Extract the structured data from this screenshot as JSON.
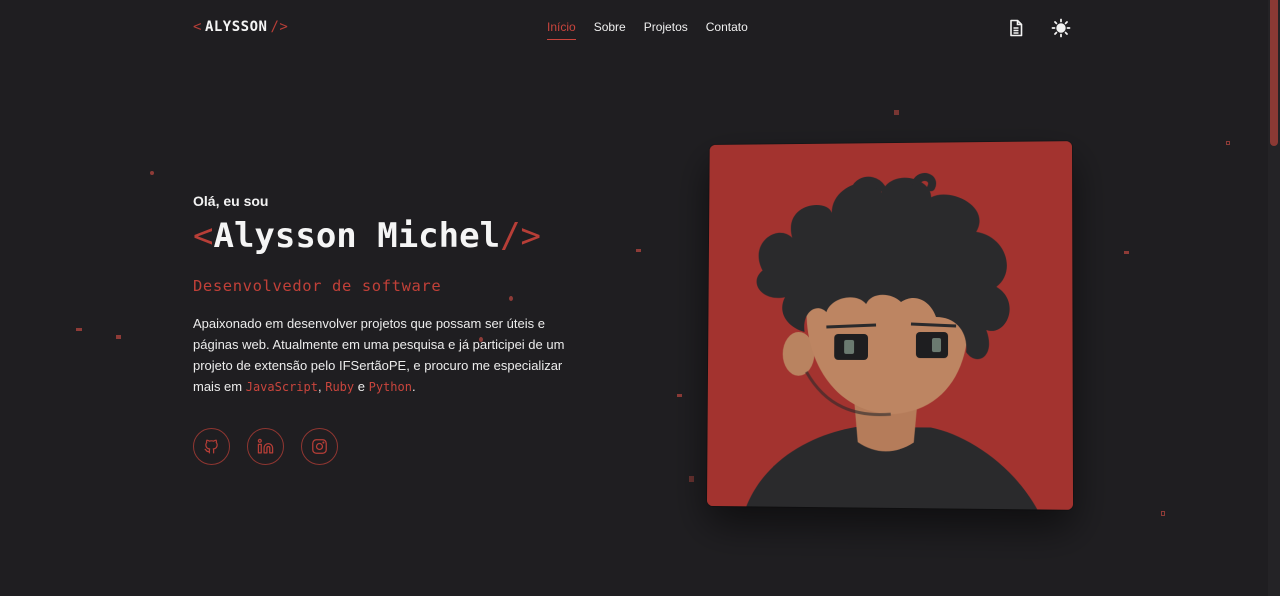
{
  "header": {
    "logo_open": "<",
    "logo_text": "ALYSSON",
    "logo_close": "/>",
    "nav": [
      {
        "label": "Início",
        "active": true
      },
      {
        "label": "Sobre",
        "active": false
      },
      {
        "label": "Projetos",
        "active": false
      },
      {
        "label": "Contato",
        "active": false
      }
    ],
    "icons": [
      "document-icon",
      "sun-icon"
    ]
  },
  "hero": {
    "greeting": "Olá, eu sou",
    "name_open": "<",
    "name": "Alysson Michel",
    "name_close": "/>",
    "role": "Desenvolvedor de software",
    "bio_text": "Apaixonado em desenvolver projetos que possam ser úteis e páginas web. Atualmente em uma pesquisa e já participei de um projeto de extensão pelo IFSertãoPE, e procuro me especializar mais em ",
    "tech_1": "JavaScript",
    "sep_1": ", ",
    "tech_2": "Ruby",
    "sep_2": " e ",
    "tech_3": "Python",
    "bio_end": ".",
    "socials": [
      "github-icon",
      "linkedin-icon",
      "instagram-icon"
    ]
  },
  "colors": {
    "background": "#1f1e21",
    "accent": "#c9453d",
    "avatar_bg": "#a3332f"
  }
}
